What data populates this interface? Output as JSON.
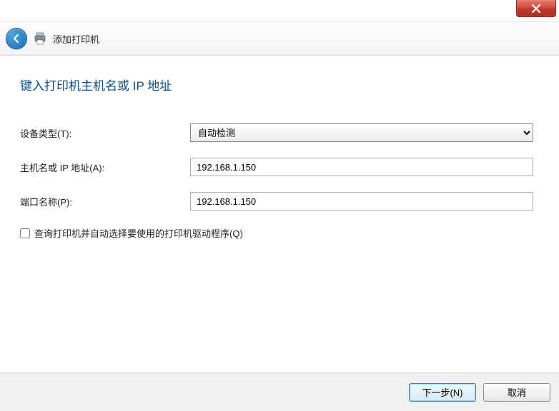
{
  "navbar": {
    "title": "添加打印机"
  },
  "page": {
    "heading": "键入打印机主机名或 IP 地址"
  },
  "form": {
    "device_type": {
      "label": "设备类型(T):",
      "value": "自动检测"
    },
    "hostname": {
      "label": "主机名或 IP 地址(A):",
      "value": "192.168.1.150"
    },
    "port_name": {
      "label": "端口名称(P):",
      "value": "192.168.1.150"
    },
    "query_checkbox": {
      "label": "查询打印机并自动选择要使用的打印机驱动程序(Q)"
    }
  },
  "footer": {
    "next": "下一步(N)",
    "cancel": "取消"
  }
}
